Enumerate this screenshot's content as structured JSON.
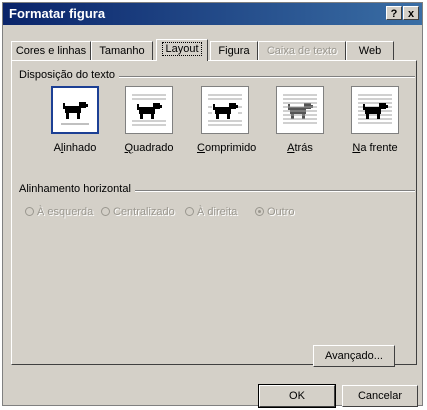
{
  "window": {
    "title": "Formatar figura",
    "help_label": "?",
    "close_label": "x"
  },
  "tabs": [
    {
      "label": "Cores e linhas",
      "state": "normal"
    },
    {
      "label": "Tamanho",
      "state": "normal"
    },
    {
      "label": "Layout",
      "state": "active"
    },
    {
      "label": "Figura",
      "state": "normal"
    },
    {
      "label": "Caixa de texto",
      "state": "disabled"
    },
    {
      "label": "Web",
      "state": "normal"
    }
  ],
  "wrapping": {
    "group_label": "Disposição do texto",
    "options": [
      {
        "label": "Alinhado",
        "mnemonic": "l",
        "icon": "dog-inline-icon",
        "selected": true
      },
      {
        "label": "Quadrado",
        "mnemonic": "Q",
        "icon": "dog-square-icon",
        "selected": false
      },
      {
        "label": "Comprimido",
        "mnemonic": "C",
        "icon": "dog-tight-icon",
        "selected": false
      },
      {
        "label": "Atrás",
        "mnemonic": "A",
        "icon": "dog-behind-icon",
        "selected": false
      },
      {
        "label": "Na frente",
        "mnemonic": "N",
        "icon": "dog-front-icon",
        "selected": false
      }
    ]
  },
  "alignment": {
    "group_label": "Alinhamento horizontal",
    "options": [
      {
        "label": "À esquerda",
        "checked": false
      },
      {
        "label": "Centralizado",
        "checked": false
      },
      {
        "label": "À direita",
        "checked": false
      },
      {
        "label": "Outro",
        "checked": true
      }
    ]
  },
  "buttons": {
    "advanced": "Avançado...",
    "ok": "OK",
    "cancel": "Cancelar"
  },
  "colors": {
    "titlebar_start": "#0a246a",
    "titlebar_end": "#3a6ea5",
    "dialog_face": "#d4d0c8",
    "selection_border": "#1c3f94"
  }
}
